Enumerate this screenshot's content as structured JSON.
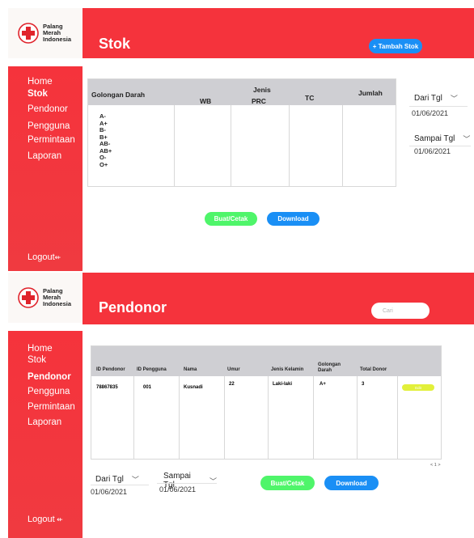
{
  "logo": {
    "lines": [
      "Palang",
      "Merah",
      "Indonesia"
    ]
  },
  "nav": [
    "Home",
    "Stok",
    "Pendonor",
    "Pengguna",
    "Permintaan",
    "Laporan"
  ],
  "logout_label": "Logout",
  "stok": {
    "title": "Stok",
    "add_button": "+ Tambah Stok",
    "headers": {
      "golongan": "Golongan Darah",
      "jenis": "Jenis",
      "wb": "WB",
      "prc": "PRC",
      "tc": "TC",
      "jumlah": "Jumlah"
    },
    "blood_types": [
      "A-",
      "A+",
      "B-",
      "B+",
      "AB-",
      "AB+",
      "O-",
      "O+"
    ],
    "dari_label": "Dari Tgl",
    "dari_value": "01/06/2021",
    "sampai_label": "Sampai Tgl",
    "sampai_value": "01/06/2021",
    "buat_button": "Buat/Cetak",
    "download_button": "Download"
  },
  "pendonor": {
    "title": "Pendonor",
    "search_placeholder": "Cari",
    "headers": [
      "ID Pendonor",
      "ID Pengguna",
      "Nama",
      "Umur",
      "Jenis Kelamin",
      "Golongan Darah",
      "Total Donor"
    ],
    "row": {
      "id_pendonor": "78867835",
      "id_pengguna": "001",
      "nama": "Kusnadi",
      "umur": "22",
      "jenis_kelamin": "Laki-laki",
      "golongan": "A+",
      "total": "3",
      "action": "Edit"
    },
    "pagination": "< 1 >",
    "dari_label": "Dari Tgl",
    "dari_value": "01/06/2021",
    "sampai_label": "Sampai Tgl",
    "sampai_value": "01/06/2021",
    "buat_button": "Buat/Cetak",
    "download_button": "Download"
  },
  "colors": {
    "header_red": "#f5333c",
    "green": "#4ff56a",
    "blue": "#1a8ff5"
  }
}
